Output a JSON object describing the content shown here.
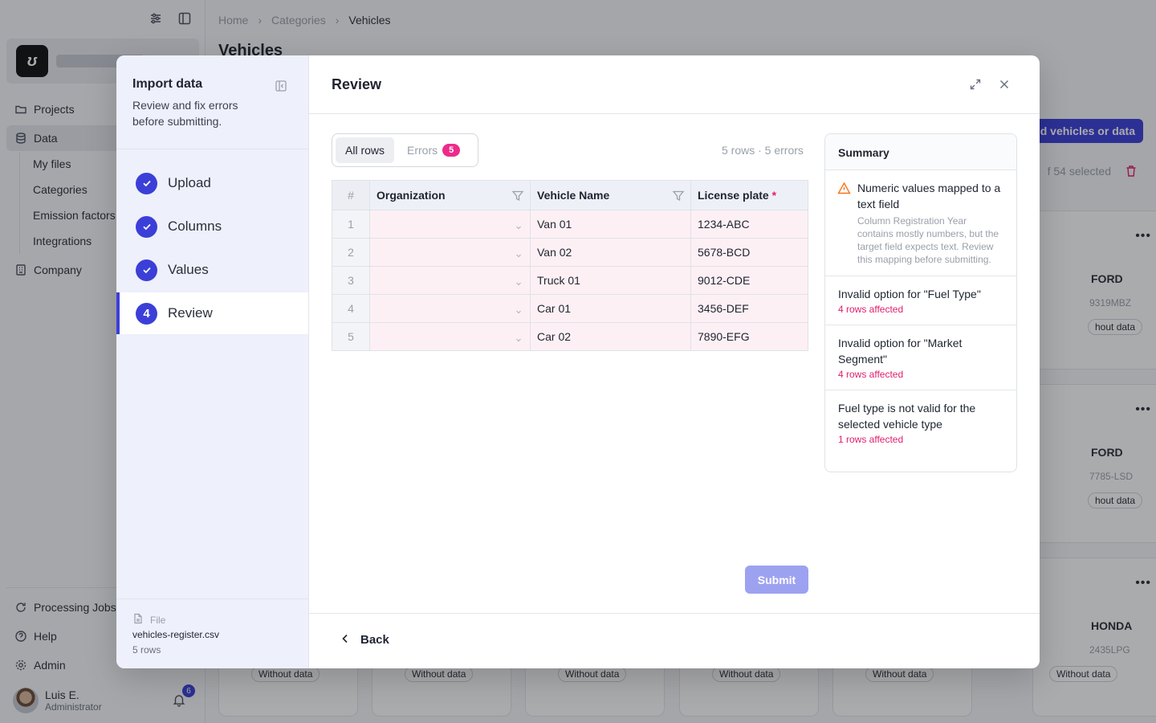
{
  "app": {
    "nav": [
      {
        "label": "Projects",
        "icon": "folder-icon"
      },
      {
        "label": "Data",
        "icon": "database-icon"
      },
      {
        "label": "Company",
        "icon": "building-icon"
      }
    ],
    "data_sub": [
      "My files",
      "Categories",
      "Emission factors",
      "Integrations"
    ],
    "bottom_nav": [
      {
        "label": "Processing Jobs",
        "icon": "refresh-icon"
      },
      {
        "label": "Help",
        "icon": "help-icon"
      },
      {
        "label": "Admin",
        "icon": "gear-icon"
      }
    ],
    "user": {
      "name": "Luis E.",
      "role": "Administrator",
      "notifications": "6"
    }
  },
  "page": {
    "breadcrumb": [
      "Home",
      "Categories",
      "Vehicles"
    ],
    "title": "Vehicles",
    "add_button": "d vehicles or data",
    "selected_text": "f 54 selected",
    "cards": [
      {
        "brand": "FORD",
        "plate": "9319MBZ",
        "status": "hout data"
      },
      {
        "brand": "FORD",
        "plate": "7785-LSD",
        "status": "hout data"
      },
      {
        "brand": "HONDA",
        "plate": "2435LPG",
        "status": "Without data"
      }
    ],
    "bottom_pills": [
      "Without data",
      "Without data",
      "Without data",
      "Without data",
      "Without data"
    ]
  },
  "modal": {
    "left": {
      "title": "Import data",
      "subtitle": "Review and fix errors before submitting.",
      "steps": [
        {
          "label": "Upload",
          "state": "done"
        },
        {
          "label": "Columns",
          "state": "done"
        },
        {
          "label": "Values",
          "state": "done"
        },
        {
          "label": "Review",
          "state": "active",
          "number": "4"
        }
      ],
      "file": {
        "label": "File",
        "name": "vehicles-register.csv",
        "rows": "5 rows"
      }
    },
    "title": "Review",
    "tabs": {
      "all": "All rows",
      "errors": "Errors",
      "error_count": "5"
    },
    "row_count": "5 rows · 5 errors",
    "table": {
      "headers": {
        "num": "#",
        "org": "Organization",
        "name": "Vehicle Name",
        "plate": "License plate",
        "required": "*"
      },
      "rows": [
        {
          "n": "1",
          "org": "",
          "name": "Van 01",
          "plate": "1234-ABC"
        },
        {
          "n": "2",
          "org": "",
          "name": "Van 02",
          "plate": "5678-BCD"
        },
        {
          "n": "3",
          "org": "",
          "name": "Truck 01",
          "plate": "9012-CDE"
        },
        {
          "n": "4",
          "org": "",
          "name": "Car 01",
          "plate": "3456-DEF"
        },
        {
          "n": "5",
          "org": "",
          "name": "Car 02",
          "plate": "7890-EFG"
        }
      ]
    },
    "submit": "Submit",
    "back": "Back",
    "summary": {
      "title": "Summary",
      "items": [
        {
          "title": "Numeric values mapped to a text field",
          "desc": "Column Registration Year contains mostly numbers, but the target field expects text. Review this mapping before submitting.",
          "warning": true
        },
        {
          "title": "Invalid option for \"Fuel Type\"",
          "affected": "4 rows affected"
        },
        {
          "title": "Invalid option for \"Market Segment\"",
          "affected": "4 rows affected"
        },
        {
          "title": "Fuel type is not valid for the selected vehicle type",
          "affected": "1 rows affected"
        }
      ]
    },
    "colors": {
      "accent": "#3b3fd8",
      "error": "#e11d6c",
      "error_row": "#fdf0f4",
      "warning": "#f97316"
    }
  }
}
